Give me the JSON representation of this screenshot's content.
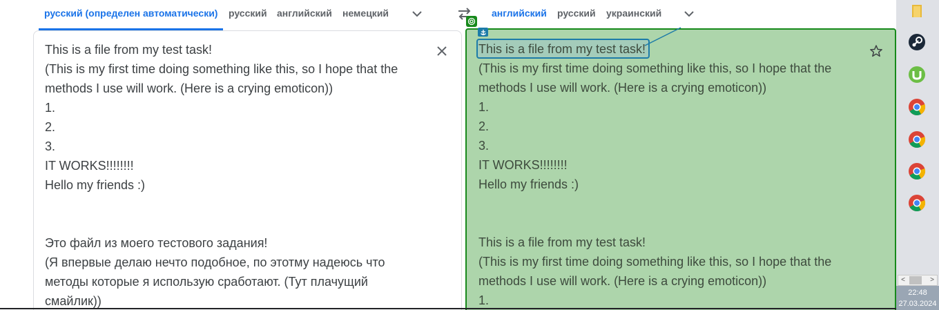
{
  "source_langs": {
    "tabs": [
      {
        "label": "русский (определен автоматически)",
        "active": true
      },
      {
        "label": "русский",
        "active": false
      },
      {
        "label": "английский",
        "active": false
      },
      {
        "label": "немецкий",
        "active": false
      }
    ],
    "more_icon": "chevron-down-icon"
  },
  "swap_icon": "swap-arrows-icon",
  "target_langs": {
    "tabs": [
      {
        "label": "английский",
        "active": true
      },
      {
        "label": "русский",
        "active": false
      },
      {
        "label": "украинский",
        "active": false
      }
    ],
    "more_icon": "chevron-down-icon"
  },
  "source": {
    "lines": [
      "This is a file from my test task!",
      "(This is my first time doing something like this, so I hope that the",
      "methods I use will work. (Here is a crying emoticon))",
      "1.",
      "2.",
      "3.",
      "IT WORKS!!!!!!!!",
      "Hello my friends :)",
      "",
      "",
      "Это файл из моего тестового задания!",
      "(Я впервые делаю нечто подобное, по этотму надеюсь что",
      "методы которые я использую сработают. (Тут плачущий",
      "смайлик))"
    ],
    "clear_icon": "close-icon"
  },
  "target": {
    "lines": [
      "This is a file from my test task!",
      "(This is my first time doing something like this, so I hope that the",
      "methods I use will work. (Here is a crying emoticon))",
      "1.",
      "2.",
      "3.",
      "IT WORKS!!!!!!!!",
      "Hello my friends :)",
      "",
      "",
      "This is a file from my test task!",
      "(This is my first time doing something like this, so I hope that the",
      "methods I use will work. (Here is a crying emoticon))",
      "1."
    ],
    "star_icon": "star-outline-icon",
    "overlay_color": "#add5ab",
    "overlay_border": "#17891b",
    "highlight_color": "#1c7ba8"
  },
  "taskbar": {
    "icons": [
      "folder-icon",
      "steam-icon",
      "utorrent-icon",
      "chrome-icon",
      "chrome-icon",
      "chrome-icon",
      "chrome-icon"
    ],
    "time": "22:48",
    "date": "27.03.2024",
    "scroll_left": "<",
    "scroll_right": ">"
  },
  "colors": {
    "accent": "#1a73e8",
    "text": "#3c4043",
    "muted": "#5f6368"
  }
}
